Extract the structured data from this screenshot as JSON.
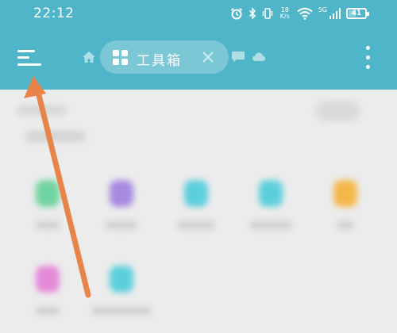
{
  "status_bar": {
    "time": "22:12",
    "net_speed_value": "18",
    "net_speed_unit": "K/s",
    "network_type": "5G",
    "battery": "41"
  },
  "toolbar": {
    "menu_icon": "hamburger-menu-icon",
    "home_icon": "home-icon",
    "tab_icon": "grid-icon",
    "tab_label": "工具箱",
    "tab_close_icon": "close-icon",
    "chat_icon": "chat-bubble-icon",
    "cloud_icon": "cloud-icon",
    "more_icon": "more-vertical-icon"
  },
  "colors": {
    "toolbar_bg": "#4fb5c8",
    "content_bg": "#ececec",
    "arrow": "#e8834a"
  },
  "content": {
    "app_rows": [
      [
        {
          "icon_color": "#6fd3a1"
        },
        {
          "icon_color": "#a78ae0"
        },
        {
          "icon_color": "#5ccfdc"
        },
        {
          "icon_color": "#5ccfdc"
        },
        {
          "icon_color": "#f3b84a"
        }
      ],
      [
        {
          "icon_color": "#e58ad9"
        },
        {
          "icon_color": "#5ccfdc"
        }
      ]
    ]
  }
}
